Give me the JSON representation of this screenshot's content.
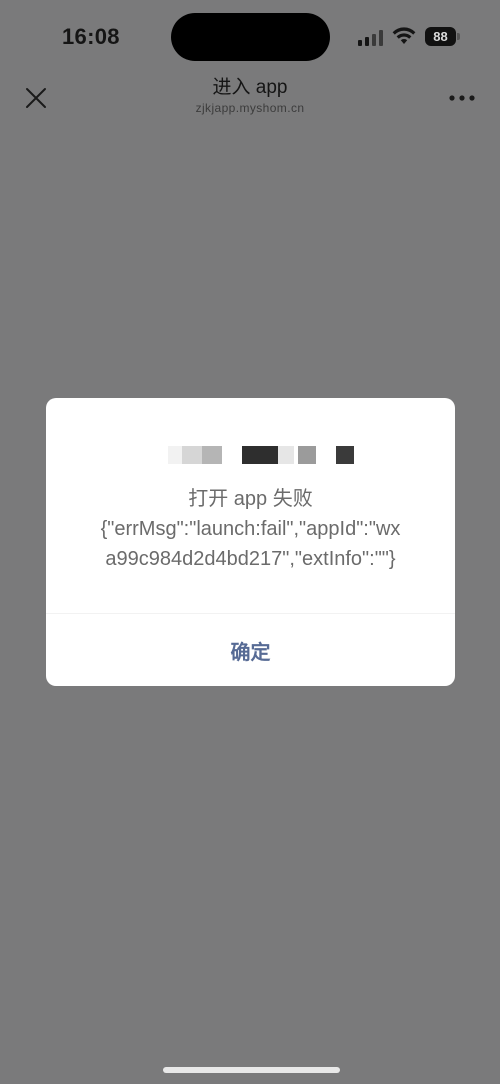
{
  "status_bar": {
    "time": "16:08",
    "battery": "88",
    "icons": [
      "signal-icon",
      "wifi-icon",
      "battery-icon"
    ]
  },
  "nav": {
    "title": "进入 app",
    "subtitle": "zjkjapp.myshom.cn",
    "close_icon": "close-icon",
    "more_icon": "more-icon"
  },
  "dialog": {
    "message_lines": [
      "打开 app 失败",
      "{\"errMsg\":\"launch:fail\",\"appId\":\"wx",
      "a99c984d2d4bd217\",\"extInfo\":\"\"}"
    ],
    "confirm_label": "确定"
  },
  "colors": {
    "backdrop": "#7a7a7b",
    "link": "#576b95",
    "message": "#6b6b6b"
  }
}
